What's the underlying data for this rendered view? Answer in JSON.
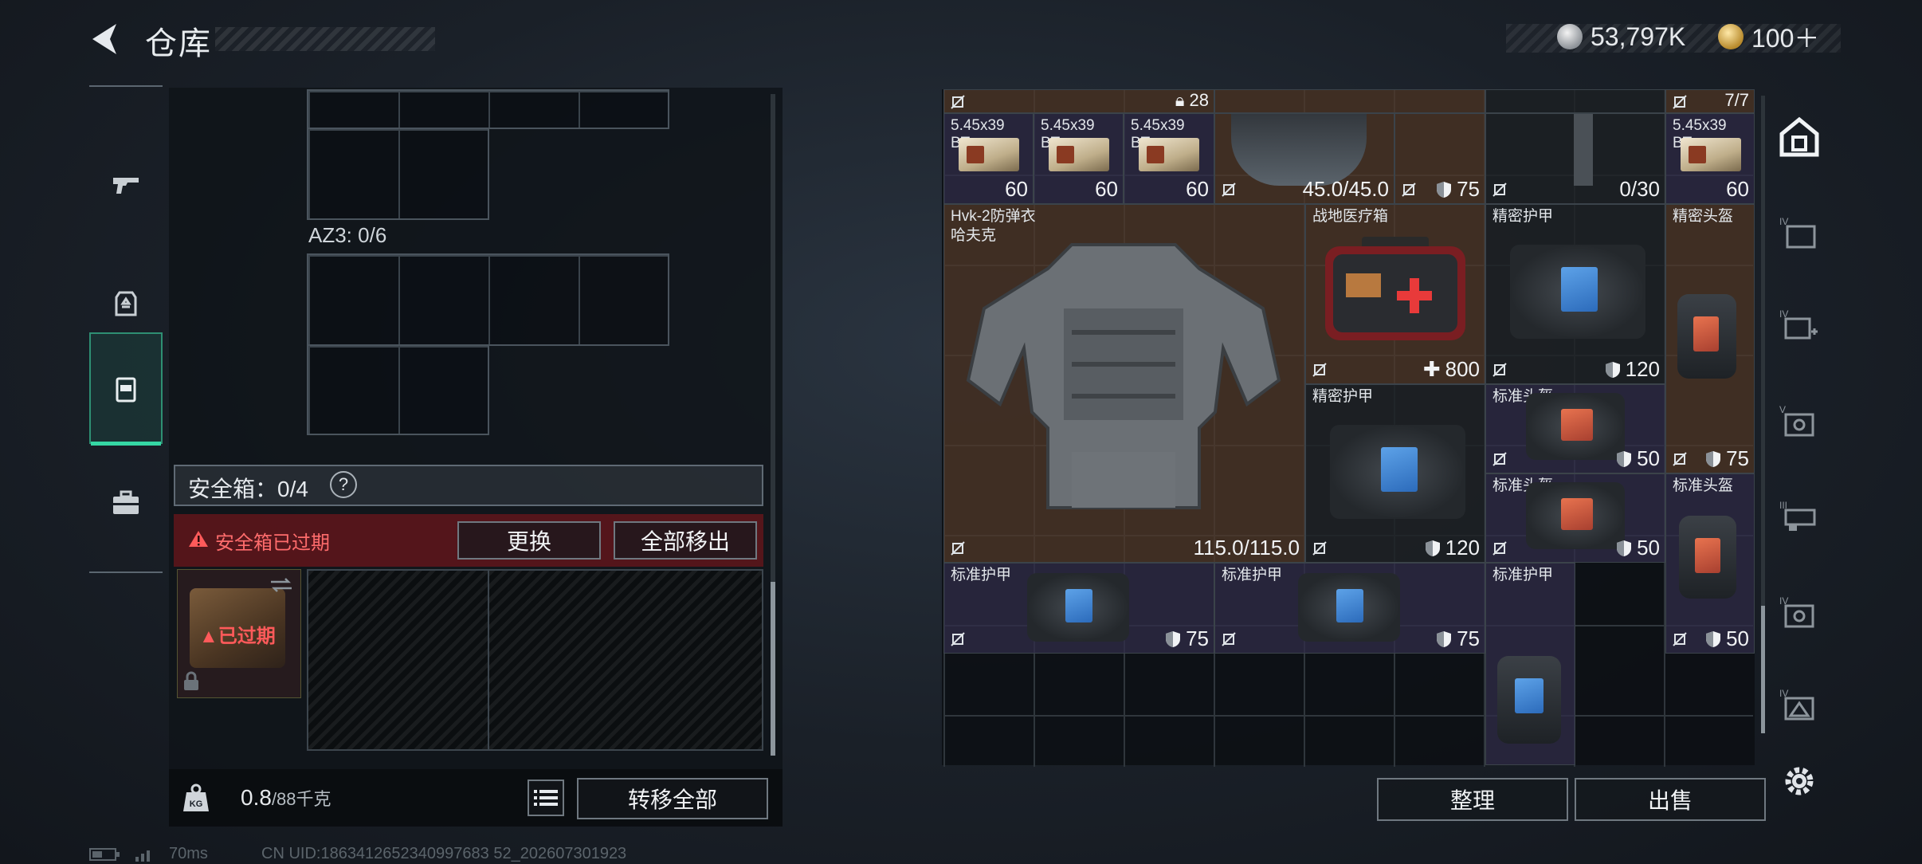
{
  "header": {
    "title": "仓库",
    "currency_silver": "53,797K",
    "currency_gold": "100＋"
  },
  "left_rail": {
    "items": [
      {
        "name": "weapons",
        "icon": "pistol-icon",
        "active": false
      },
      {
        "name": "backpack",
        "icon": "backpack-icon",
        "active": false
      },
      {
        "name": "rig",
        "icon": "chest-rig-icon",
        "active": true
      },
      {
        "name": "case",
        "icon": "briefcase-icon",
        "active": false
      }
    ]
  },
  "container": {
    "az3_label": "AZ3: 0/6",
    "safe_label": "安全箱：0/4",
    "help": "?",
    "expired_text": "安全箱已过期",
    "replace_button": "更换",
    "remove_all_button": "全部移出",
    "expired_badge": "已过期",
    "weight_value": "0.8",
    "weight_unit": "/88千克",
    "transfer_all_button": "转移全部"
  },
  "stash": {
    "top_row": {
      "count_28": "28",
      "count_777": "7/7"
    },
    "ammo": [
      {
        "name": "5.45x39",
        "sub": "BT",
        "count": "60"
      },
      {
        "name": "5.45x39",
        "sub": "BT",
        "count": "60"
      },
      {
        "name": "5.45x39",
        "sub": "BT",
        "count": "60"
      },
      {
        "name": "5.45x39",
        "sub": "BT",
        "count": "60"
      }
    ],
    "helmet_durability": "45.0/45.0",
    "helmet_shield": "75",
    "mag_count": "0/30",
    "items": [
      {
        "name": "Hvk-2防弹衣",
        "sub": "哈夫克",
        "value": "115.0/115.0"
      },
      {
        "name": "战地医疗箱",
        "value": "800"
      },
      {
        "name": "精密护甲",
        "value": "120"
      },
      {
        "name": "精密头盔",
        "value": "75"
      },
      {
        "name": "精密护甲",
        "value": "120"
      },
      {
        "name": "标准头盔",
        "value": "50"
      },
      {
        "name": "标准头盔",
        "value": "50"
      },
      {
        "name": "标准头盔",
        "value": "50"
      },
      {
        "name": "标准护甲",
        "value": "75"
      },
      {
        "name": "标准护甲",
        "value": "75"
      },
      {
        "name": "标准护甲",
        "value": ""
      }
    ],
    "sort_button": "整理",
    "sell_button": "出售"
  },
  "right_rail": {
    "items": [
      "home-icon",
      "tier4-backpack-icon",
      "tier4-medkit-icon",
      "tier5-safe-icon",
      "tier3-rig-icon",
      "tier4-safe-icon",
      "tier4-tactical-icon"
    ]
  },
  "status": {
    "ping": "70ms",
    "uid": "CN UID:1863412652340997683 52_202607301923"
  },
  "colors": {
    "accent": "#35d7a4",
    "danger": "#ff5a5a",
    "brown_cell": "#50382a",
    "purple_cell": "#302c48"
  }
}
